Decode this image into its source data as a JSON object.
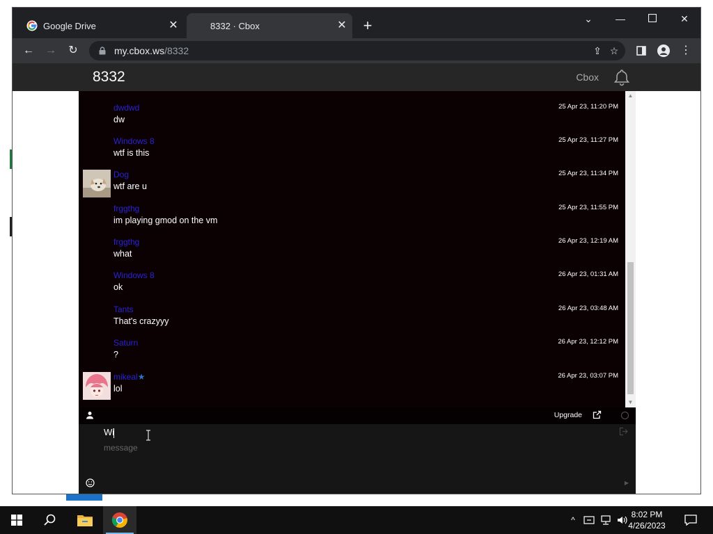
{
  "browser": {
    "tabs": [
      {
        "title": "Google Drive",
        "active": false
      },
      {
        "title": "8332 · Cbox",
        "active": true
      }
    ],
    "url_host": "my.cbox.ws",
    "url_path": "/8332"
  },
  "cbox": {
    "room_title": "8332",
    "brand": "Cbox",
    "messages": [
      {
        "name": "dwdwd",
        "text": "dw",
        "time": "25 Apr 23, 11:20 PM",
        "avatar": null,
        "verified": false
      },
      {
        "name": "Windows 8",
        "text": "wtf is this",
        "time": "25 Apr 23, 11:27 PM",
        "avatar": null,
        "verified": false
      },
      {
        "name": "Dog",
        "text": "wtf are u",
        "time": "25 Apr 23, 11:34 PM",
        "avatar": "dog",
        "verified": false
      },
      {
        "name": "frggthg",
        "text": "im playing gmod on the vm",
        "time": "25 Apr 23, 11:55 PM",
        "avatar": null,
        "verified": false
      },
      {
        "name": "frggthg",
        "text": "what",
        "time": "26 Apr 23, 12:19 AM",
        "avatar": null,
        "verified": false
      },
      {
        "name": "Windows 8",
        "text": "ok",
        "time": "26 Apr 23, 01:31 AM",
        "avatar": null,
        "verified": false
      },
      {
        "name": "Tants",
        "text": "That's crazyyy",
        "time": "26 Apr 23, 03:48 AM",
        "avatar": null,
        "verified": false
      },
      {
        "name": "Saturn",
        "text": "?",
        "time": "26 Apr 23, 12:12 PM",
        "avatar": null,
        "verified": false
      },
      {
        "name": "mikeal",
        "text": "lol",
        "time": "26 Apr 23, 03:07 PM",
        "avatar": "anime",
        "verified": true
      }
    ],
    "controlbar": {
      "upgrade_label": "Upgrade"
    },
    "composer": {
      "name_value": "Wi",
      "message_placeholder": "message"
    }
  },
  "taskbar": {
    "time": "8:02 PM",
    "date": "4/26/2023"
  },
  "colors": {
    "chat_bg": "#0b0103",
    "username": "#2a22d6",
    "header_bg": "#262626",
    "tab_bar": "#202124",
    "toolbar": "#35363a"
  }
}
